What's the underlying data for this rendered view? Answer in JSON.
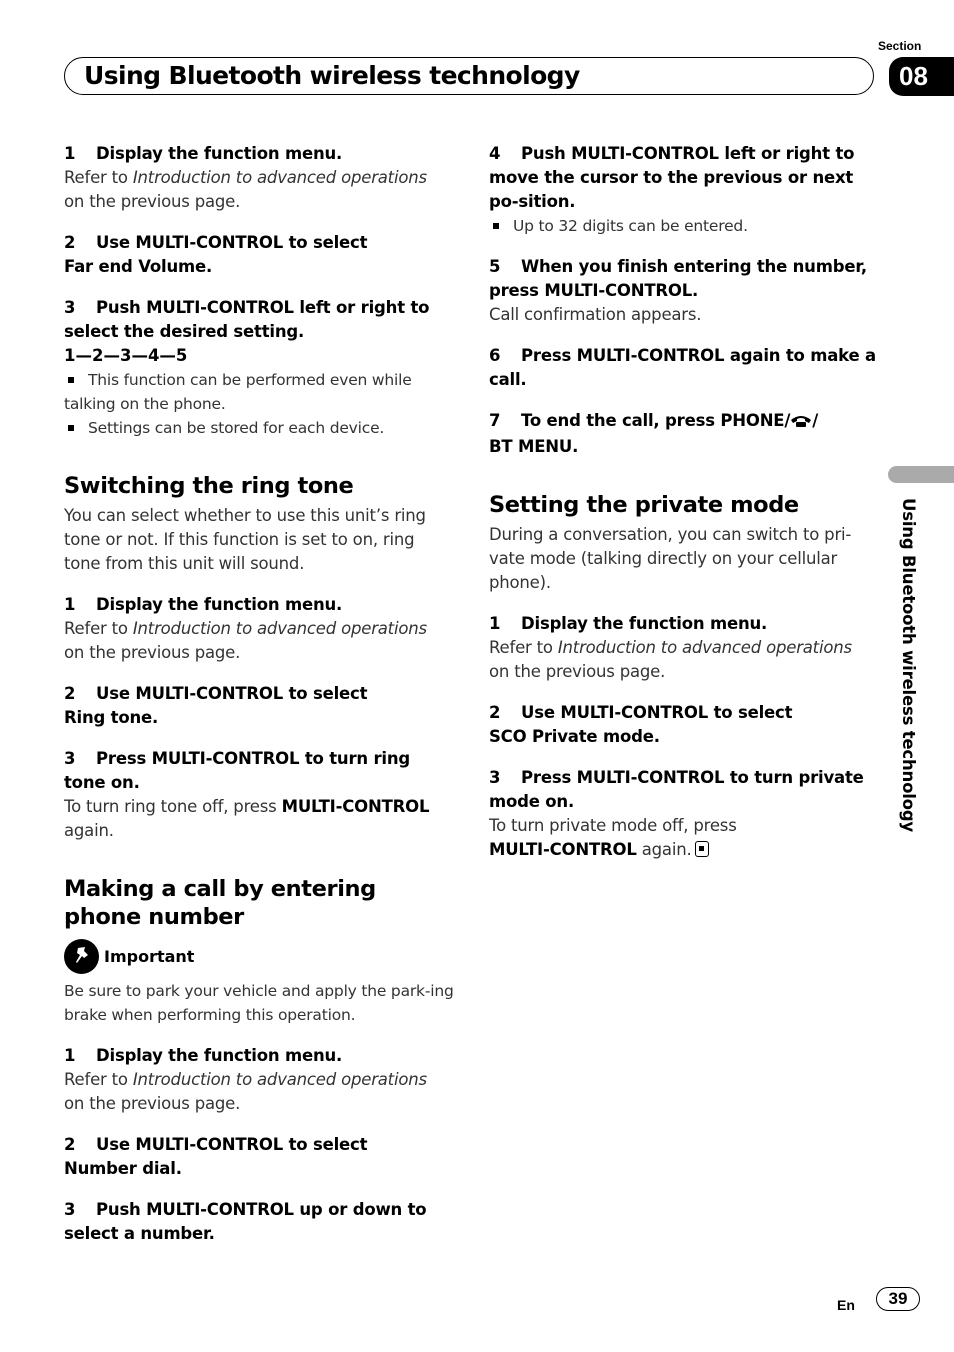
{
  "header": {
    "section_label": "Section",
    "section_number": "08",
    "title": "Using Bluetooth wireless technology"
  },
  "left": {
    "block1": {
      "steps": [
        {
          "num": "1",
          "text": "Display the function menu.",
          "body_prefix": "Refer to ",
          "body_italic": "Introduction to advanced operations",
          "body_suffix": "on the previous page."
        },
        {
          "num": "2",
          "text": "Use MULTI-CONTROL to select",
          "text2": "Far end Volume."
        },
        {
          "num": "3",
          "text": "Push MULTI-CONTROL left or right to select the desired setting."
        }
      ],
      "levels": "1—2—3—4—5",
      "notes": [
        "This function can be performed even while talking on the phone.",
        "Settings can be stored for each device."
      ]
    },
    "ring_tone": {
      "heading": "Switching the ring tone",
      "intro": "You can select whether to use this unit’s ring tone or not. If this function is set to on, ring tone from this unit will sound.",
      "steps": [
        {
          "num": "1",
          "text": "Display the function menu.",
          "body_prefix": "Refer to ",
          "body_italic": "Introduction to advanced operations",
          "body_suffix": "on the previous page."
        },
        {
          "num": "2",
          "text": "Use MULTI-CONTROL to select",
          "text2": "Ring tone."
        },
        {
          "num": "3",
          "text": "Press MULTI-CONTROL to turn ring tone on.",
          "body_prefix": "To turn ring tone off, press ",
          "body_bold": "MULTI-CONTROL",
          "body_suffix": "again."
        }
      ]
    },
    "making_call": {
      "heading": "Making a call by entering phone number",
      "important_label": "Important",
      "important_text": "Be sure to park your vehicle and apply the park-ing brake when performing this operation.",
      "steps": [
        {
          "num": "1",
          "text": "Display the function menu.",
          "body_prefix": "Refer to ",
          "body_italic": "Introduction to advanced operations",
          "body_suffix": "on the previous page."
        },
        {
          "num": "2",
          "text": "Use MULTI-CONTROL to select",
          "text2": "Number dial."
        },
        {
          "num": "3",
          "text": "Push MULTI-CONTROL up or down to select a number."
        }
      ]
    }
  },
  "right": {
    "making_call_cont": {
      "steps": [
        {
          "num": "4",
          "text": "Push MULTI-CONTROL left or right to move the cursor to the previous or next po-sition.",
          "note": "Up to 32 digits can be entered."
        },
        {
          "num": "5",
          "text": "When you finish entering the number, press MULTI-CONTROL.",
          "body": "Call confirmation appears."
        },
        {
          "num": "6",
          "text": "Press MULTI-CONTROL again to make a call."
        },
        {
          "num": "7",
          "text_prefix": "To end the call, press PHONE/",
          "text_suffix": "/",
          "text2": "BT MENU."
        }
      ]
    },
    "private_mode": {
      "heading": "Setting the private mode",
      "intro": "During a conversation, you can switch to pri-vate mode (talking directly on your cellular phone).",
      "steps": [
        {
          "num": "1",
          "text": "Display the function menu.",
          "body_prefix": "Refer to ",
          "body_italic": "Introduction to advanced operations",
          "body_suffix": "on the previous page."
        },
        {
          "num": "2",
          "text": "Use MULTI-CONTROL to select",
          "text2": "SCO Private mode."
        },
        {
          "num": "3",
          "text": "Press MULTI-CONTROL to turn private mode on.",
          "body_prefix": "To turn private mode off, press",
          "body_bold": "MULTI-CONTROL",
          "body_suffix": " again."
        }
      ]
    }
  },
  "side_tab": {
    "text": "Using Bluetooth wireless technology"
  },
  "footer": {
    "language": "En",
    "page_number": "39"
  },
  "icons": {
    "important": "pushpin-icon",
    "phone": "phone-handset-icon",
    "end_mark": "end-of-section-icon",
    "bullet": "square-bullet-icon"
  }
}
